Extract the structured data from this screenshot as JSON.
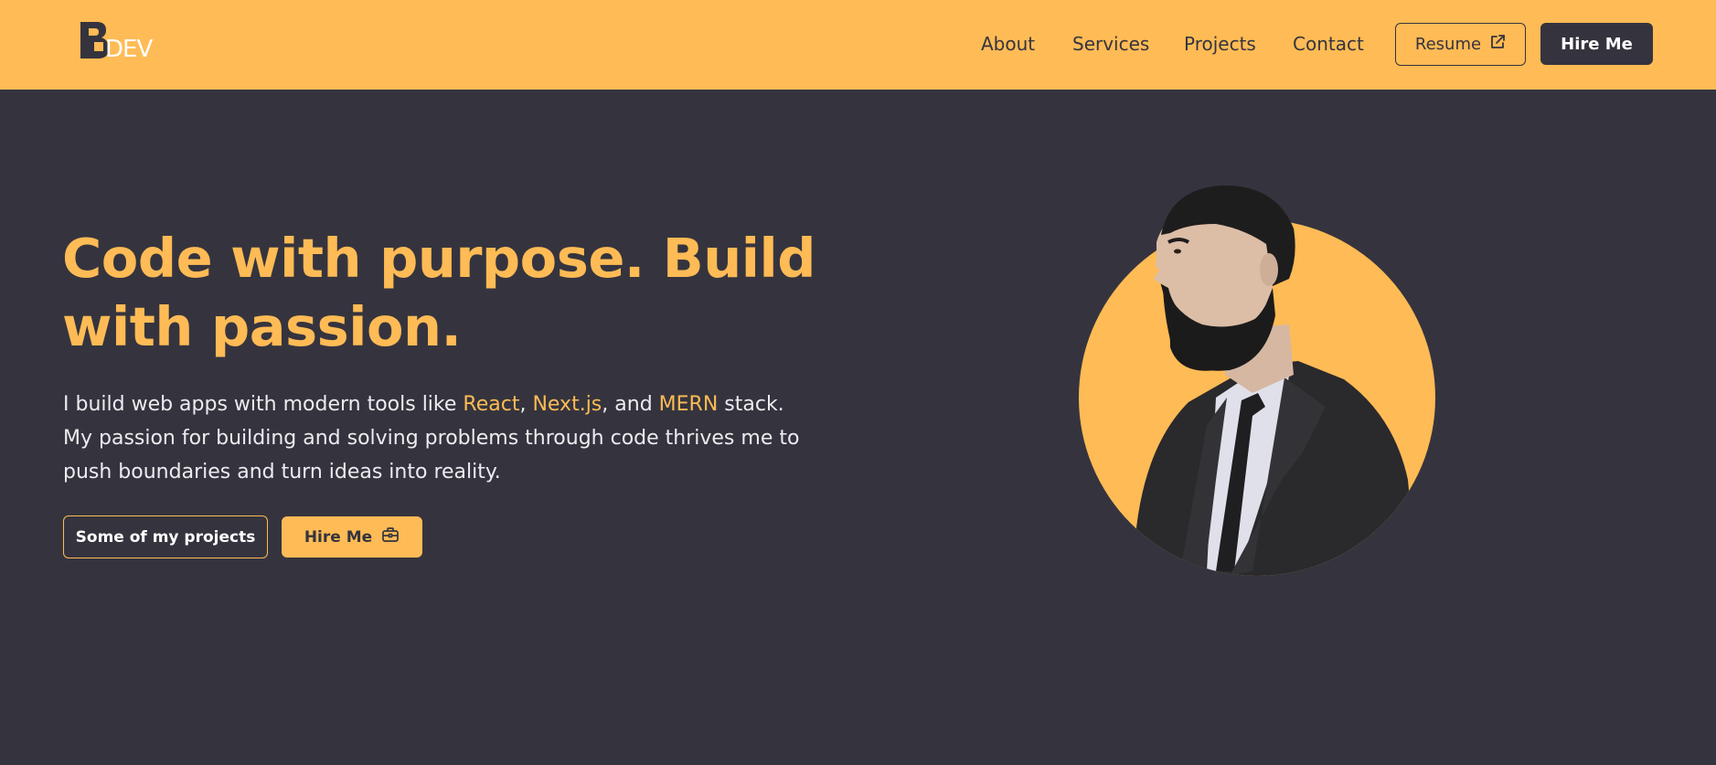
{
  "colors": {
    "accent": "#ffbb55",
    "background": "#35343e",
    "text_light": "#ececf0"
  },
  "header": {
    "logo_icon": "bdev-logo-icon",
    "nav": {
      "about": "About",
      "services": "Services",
      "projects": "Projects",
      "contact": "Contact"
    },
    "resume_label": "Resume",
    "resume_icon": "external-link-icon",
    "hire_label": "Hire Me"
  },
  "hero": {
    "headline_line1": "Code with purpose. Build",
    "headline_line2": "with passion.",
    "intro": {
      "part1": "I build web apps with modern tools like ",
      "tech1": "React",
      "sep1": ", ",
      "tech2": "Next.js",
      "sep2": ", and ",
      "tech3": "MERN",
      "part2": " stack.",
      "line2": "My passion for building and solving problems through code thrives me to",
      "line3": "push boundaries and turn ideas into reality."
    },
    "projects_button": "Some of my projects",
    "hire_button": "Hire Me",
    "hire_icon": "briefcase-icon",
    "portrait": "profile-portrait"
  }
}
